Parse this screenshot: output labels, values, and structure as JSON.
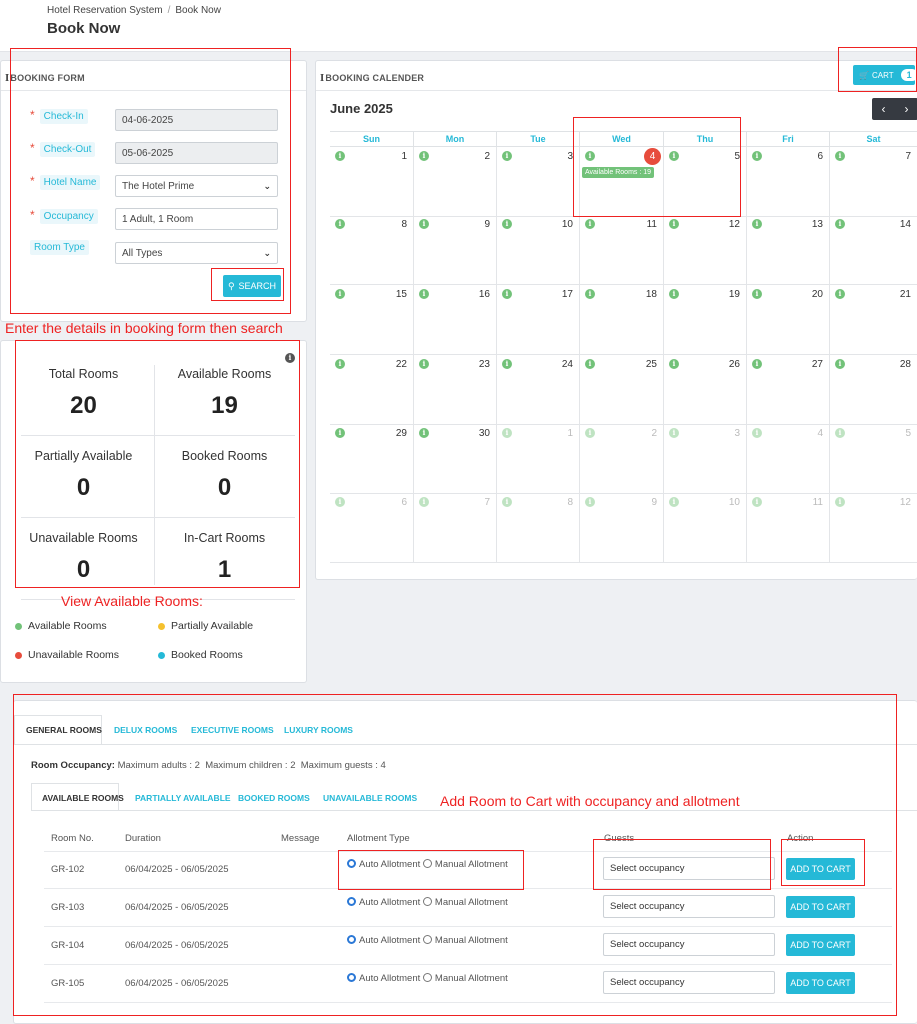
{
  "breadcrumb": {
    "items": [
      "Hotel Reservation System",
      "Book Now"
    ]
  },
  "page_title": "Book Now",
  "booking_form": {
    "title": "BOOKING FORM",
    "fields": [
      {
        "label": "Check-In",
        "value": "04-06-2025",
        "required": true,
        "type": "date"
      },
      {
        "label": "Check-Out",
        "value": "05-06-2025",
        "required": true,
        "type": "date"
      },
      {
        "label": "Hotel Name",
        "value": "The Hotel Prime",
        "required": true,
        "type": "select"
      },
      {
        "label": "Occupancy",
        "value": "1 Adult, 1 Room",
        "required": true,
        "type": "text"
      },
      {
        "label": "Room Type",
        "value": "All Types",
        "required": false,
        "type": "select"
      }
    ],
    "search_label": "SEARCH"
  },
  "annotations": {
    "form_hint": "Enter the details in booking form then search",
    "stats_hint": "View Available Rooms:",
    "table_hint": "Add Room to Cart with occupancy and allotment"
  },
  "stats": [
    {
      "label": "Total Rooms",
      "value": "20"
    },
    {
      "label": "Available Rooms",
      "value": "19"
    },
    {
      "label": "Partially Available",
      "value": "0"
    },
    {
      "label": "Booked Rooms",
      "value": "0"
    },
    {
      "label": "Unavailable Rooms",
      "value": "0"
    },
    {
      "label": "In-Cart Rooms",
      "value": "1"
    }
  ],
  "legend": [
    {
      "label": "Available Rooms",
      "color": "#72c279"
    },
    {
      "label": "Partially Available",
      "color": "#f5c12e"
    },
    {
      "label": "Unavailable Rooms",
      "color": "#e74c3c"
    },
    {
      "label": "Booked Rooms",
      "color": "#25b9d7"
    }
  ],
  "calendar": {
    "title": "BOOKING CALENDER",
    "cart_label": "CART",
    "cart_count": "1",
    "month": "June 2025",
    "weekdays": [
      "Sun",
      "Mon",
      "Tue",
      "Wed",
      "Thu",
      "Fri",
      "Sat"
    ],
    "weeks": [
      [
        "1",
        "2",
        "3",
        "4",
        "5",
        "6",
        "7"
      ],
      [
        "8",
        "9",
        "10",
        "11",
        "12",
        "13",
        "14"
      ],
      [
        "15",
        "16",
        "17",
        "18",
        "19",
        "20",
        "21"
      ],
      [
        "22",
        "23",
        "24",
        "25",
        "26",
        "27",
        "28"
      ],
      [
        "29",
        "30",
        "1",
        "2",
        "3",
        "4",
        "5"
      ],
      [
        "6",
        "7",
        "8",
        "9",
        "10",
        "11",
        "12"
      ]
    ],
    "today": "4",
    "today_tag": "Available Rooms : 19"
  },
  "room_tabs": [
    "GENERAL ROOMS",
    "DELUX ROOMS",
    "EXECUTIVE ROOMS",
    "LUXURY ROOMS"
  ],
  "occupancy_info": {
    "label": "Room Occupancy:",
    "text": "Maximum adults : 2  Maximum children : 2  Maximum guests : 4"
  },
  "availability_tabs": [
    "AVAILABLE ROOMS",
    "PARTIALLY AVAILABLE",
    "BOOKED ROOMS",
    "UNAVAILABLE ROOMS"
  ],
  "table": {
    "headers": [
      "Room No.",
      "Duration",
      "Message",
      "Allotment Type",
      "Guests",
      "Action"
    ],
    "rows": [
      {
        "room": "GR-102",
        "duration": "06/04/2025 - 06/05/2025"
      },
      {
        "room": "GR-103",
        "duration": "06/04/2025 - 06/05/2025"
      },
      {
        "room": "GR-104",
        "duration": "06/04/2025 - 06/05/2025"
      },
      {
        "room": "GR-105",
        "duration": "06/04/2025 - 06/05/2025"
      }
    ],
    "auto_label": "Auto Allotment",
    "manual_label": "Manual Allotment",
    "occupancy_placeholder": "Select occupancy",
    "add_label": "ADD TO CART"
  }
}
